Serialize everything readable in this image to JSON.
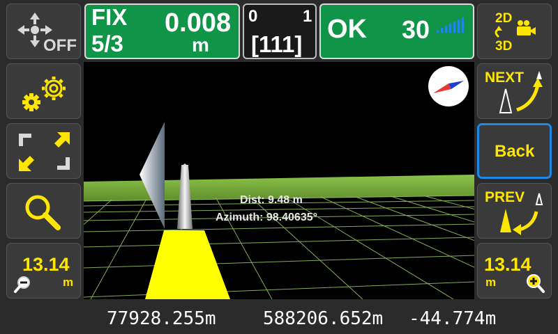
{
  "header": {
    "fix_status": "FIX",
    "fix_ratio": "5/3",
    "precision_value": "0.008",
    "precision_unit": "m",
    "counter_left": "0",
    "counter_right": "1",
    "counter_code": "[111]",
    "status_ok": "OK",
    "satellite_count": "30"
  },
  "left_toolbar": {
    "move_off_label": "OFF",
    "zoom_out_value": "13.14",
    "zoom_out_unit": "m"
  },
  "right_toolbar": {
    "mode_2d_label": "2D",
    "mode_3d_label": "3D",
    "next_label": "NEXT",
    "back_label": "Back",
    "prev_label": "PREV",
    "zoom_in_value": "13.14",
    "zoom_in_unit": "m"
  },
  "view": {
    "distance_text": "Dist: 9.48 m",
    "azimuth_text": "Azimuth: 98.40635°"
  },
  "coordinates": {
    "northing": "77928.255m",
    "easting": "588206.652m",
    "elevation": "-44.774m"
  },
  "colors": {
    "status_green": "#0f9448",
    "accent_yellow": "#ffe600",
    "signal_blue": "#1e88e5",
    "ground_green": "#8bc34a",
    "selected_border": "#1e88e5"
  },
  "icons": [
    "move-arrows-icon",
    "settings-gears-icon",
    "expand-arrows-icon",
    "search-magnifier-icon",
    "zoom-out-icon",
    "mode-2d-3d-icon",
    "camera-icon",
    "next-point-icon",
    "prev-point-icon",
    "zoom-in-icon",
    "compass-icon",
    "signal-bars-icon"
  ]
}
